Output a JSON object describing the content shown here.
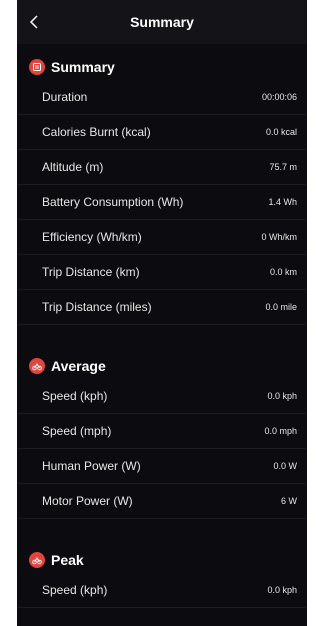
{
  "header": {
    "title": "Summary"
  },
  "summary": {
    "title": "Summary",
    "icon": "list-doc-icon",
    "rows": [
      {
        "label": "Duration",
        "value": "00:00:06"
      },
      {
        "label": "Calories Burnt (kcal)",
        "value": "0.0 kcal"
      },
      {
        "label": "Altitude (m)",
        "value": "75.7 m"
      },
      {
        "label": "Battery Consumption (Wh)",
        "value": "1.4 Wh"
      },
      {
        "label": "Efficiency (Wh/km)",
        "value": "0 Wh/km"
      },
      {
        "label": "Trip Distance (km)",
        "value": "0.0 km"
      },
      {
        "label": "Trip Distance (miles)",
        "value": "0.0 mile"
      }
    ]
  },
  "average": {
    "title": "Average",
    "icon": "bike-icon",
    "rows": [
      {
        "label": "Speed (kph)",
        "value": "0.0 kph"
      },
      {
        "label": "Speed (mph)",
        "value": "0.0 mph"
      },
      {
        "label": "Human Power (W)",
        "value": "0.0 W"
      },
      {
        "label": "Motor Power (W)",
        "value": "6 W"
      }
    ]
  },
  "peak": {
    "title": "Peak",
    "icon": "bike-icon",
    "rows": [
      {
        "label": "Speed (kph)",
        "value": "0.0 kph"
      }
    ]
  },
  "colors": {
    "background": "#0c0c10",
    "accent": "#e0463e",
    "text": "#e6e6e6"
  }
}
